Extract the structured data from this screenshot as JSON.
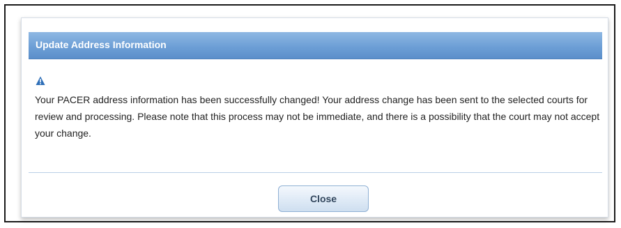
{
  "dialog": {
    "title": "Update Address Information",
    "icon": "warning-icon",
    "message": "Your PACER address information has been successfully changed! Your address change has been sent to the selected courts for review and processing. Please note that this process may not be immediate, and there is a possibility that the court may not accept your change.",
    "close_label": "Close"
  },
  "colors": {
    "title_bar": "#6d9fd6",
    "title_text": "#ffffff",
    "icon": "#2f6fb8",
    "button_border": "#8fb0d4"
  }
}
